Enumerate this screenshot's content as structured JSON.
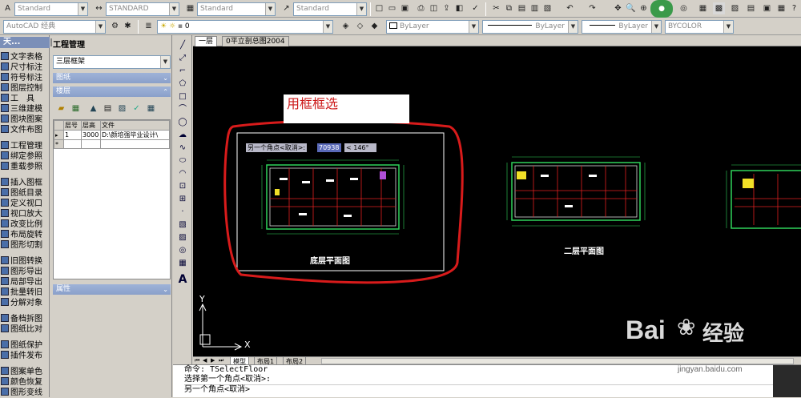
{
  "toolbar1": {
    "text_style": "Standard",
    "dim_style": "STANDARD",
    "table_style": "Standard",
    "multileader_style": "Standard"
  },
  "toolbar2": {
    "workspace": "AutoCAD 经典",
    "layer": "0",
    "color": "ByLayer",
    "linetype": "ByLayer",
    "lineweight": "ByLayer",
    "plotstyle": "BYCOLOR"
  },
  "left_tools": {
    "header": "天...",
    "items": [
      "文字表格",
      "尺寸标注",
      "符号标注",
      "图层控制",
      "工　具",
      "三维建模",
      "图块图案",
      "文件布图",
      "工程管理",
      "绑定参照",
      "重载参照",
      "插入图框",
      "图纸目录",
      "定义视口",
      "视口放大",
      "改变比例",
      "布局旋转",
      "图形切割",
      "旧图转换",
      "图形导出",
      "局部导出",
      "批量转旧",
      "分解对象",
      "备档拆图",
      "图纸比对",
      "图纸保护",
      "插件发布",
      "图案单色",
      "颜色恢复",
      "图形变线"
    ]
  },
  "project_panel": {
    "title": "工程管理",
    "project_name": "三层框架",
    "section_drawings": "图纸",
    "section_floors": "楼层",
    "section_props": "属性",
    "grid_headers": [
      "层号",
      "层高",
      "文件"
    ],
    "grid_rows": [
      [
        "1",
        "3000",
        "D:\\颜培强毕业设计\\"
      ],
      [
        "",
        "",
        ""
      ]
    ]
  },
  "canvas": {
    "tab_name": "0平立剖总图2004",
    "tab_icon_label": "一层",
    "annotation": "用框框选",
    "prompt_label": "另一个角点<取消>:",
    "prompt_value": "70938",
    "prompt_angle": "< 146°",
    "plan1_title": "底层平面图",
    "plan2_title": "二层平面图",
    "ucs_x": "X",
    "ucs_y": "Y"
  },
  "layout_tabs": [
    "模型",
    "布局1",
    "布局2"
  ],
  "command": {
    "line1": "命令: TSelectFloor",
    "line2": "选择第一个角点<取消>:",
    "line3": "另一个角点<取消>"
  },
  "watermark": {
    "brand": "Bai",
    "brand2": "经验",
    "url": "jingyan.baidu.com"
  },
  "colors": {
    "canvas_bg": "#000000",
    "highlight_red": "#d81b1b",
    "plan_green": "#2fd35a",
    "plan_red": "#e02020",
    "plan_yellow": "#f1e027"
  }
}
